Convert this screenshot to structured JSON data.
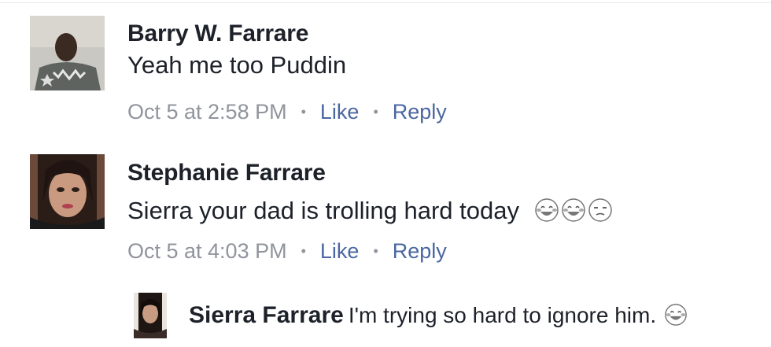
{
  "comments": [
    {
      "author": "Barry W. Farrare",
      "text": "Yeah me too Puddin",
      "time": "Oct 5 at 2:58 PM",
      "like_label": "Like",
      "reply_label": "Reply",
      "avatar_icon": "profile-photo-man"
    },
    {
      "author": "Stephanie Farrare",
      "text": "Sierra your dad is trolling hard today",
      "time": "Oct 5 at 4:03 PM",
      "like_label": "Like",
      "reply_label": "Reply",
      "emojis": [
        "face-with-tears-of-joy",
        "face-with-tears-of-joy",
        "unamused-face"
      ],
      "avatar_icon": "profile-photo-woman"
    }
  ],
  "reply": {
    "author": "Sierra Farrare",
    "text": "I'm trying so hard to ignore him.",
    "emojis": [
      "face-with-tears-of-joy"
    ],
    "avatar_icon": "profile-photo-woman"
  },
  "colors": {
    "author": "#1d2129",
    "meta": "#90949c",
    "link": "#4b67a1"
  }
}
